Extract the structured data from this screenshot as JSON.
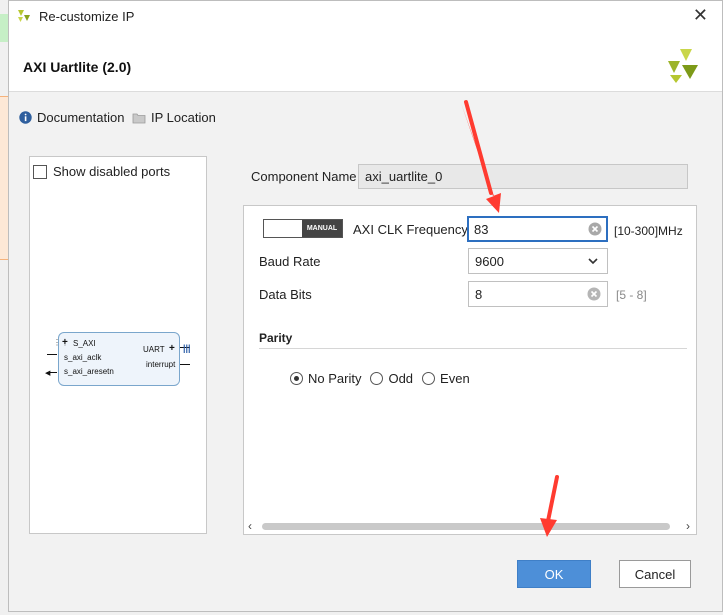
{
  "window": {
    "title": "Re-customize IP"
  },
  "header": {
    "ip_title": "AXI Uartlite (2.0)"
  },
  "links": {
    "documentation": "Documentation",
    "ip_location": "IP Location"
  },
  "left_panel": {
    "show_disabled_ports": "Show disabled ports",
    "block": {
      "s_axi": "S_AXI",
      "s_axi_aclk": "s_axi_aclk",
      "s_axi_aresetn": "s_axi_aresetn",
      "uart": "UART",
      "interrupt": "interrupt"
    }
  },
  "component": {
    "label": "Component Name",
    "value": "axi_uartlite_0"
  },
  "params": {
    "toggle_label": "MANUAL",
    "clk_label": "AXI CLK Frequency",
    "clk_value": "83",
    "clk_range": "[10-300]MHz",
    "baud_label": "Baud Rate",
    "baud_value": "9600",
    "databits_label": "Data Bits",
    "databits_value": "8",
    "databits_range": "[5 - 8]"
  },
  "parity": {
    "heading": "Parity",
    "options": [
      "No Parity",
      "Odd",
      "Even"
    ],
    "selected": "No Parity"
  },
  "buttons": {
    "ok": "OK",
    "cancel": "Cancel"
  },
  "colors": {
    "ok_button": "#4d8fd8",
    "focus_border": "#2d6fc0",
    "annotation_arrow": "#ff3b30",
    "left_strip_green": "#c6efc6",
    "left_strip_orange": "#f5b27b"
  }
}
